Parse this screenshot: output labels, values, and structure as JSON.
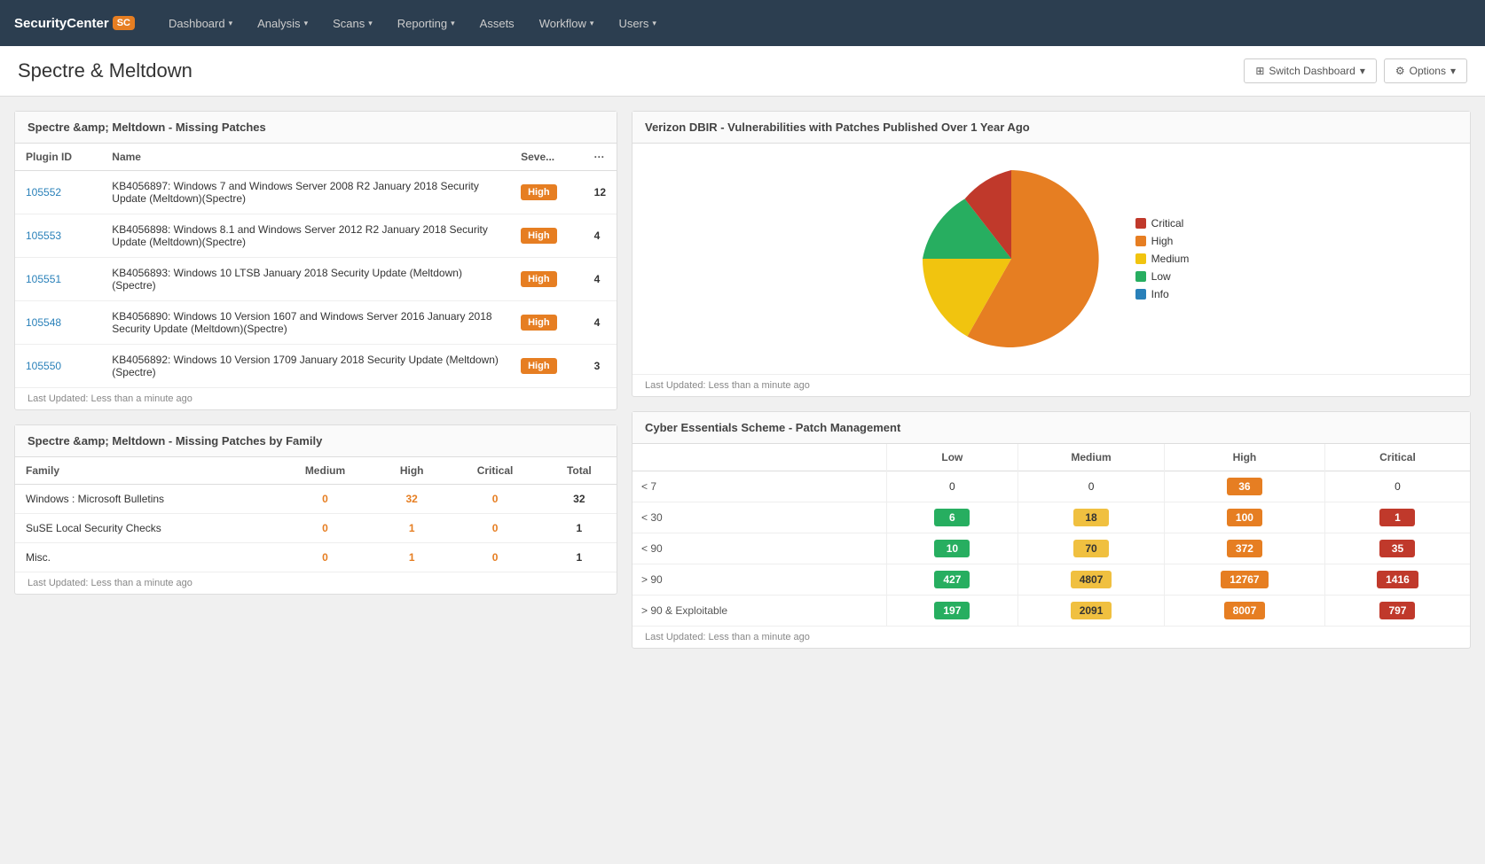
{
  "brand": {
    "name": "SecurityCenter",
    "badge": "SC"
  },
  "nav": {
    "items": [
      {
        "label": "Dashboard",
        "hasDropdown": true
      },
      {
        "label": "Analysis",
        "hasDropdown": true
      },
      {
        "label": "Scans",
        "hasDropdown": true
      },
      {
        "label": "Reporting",
        "hasDropdown": true
      },
      {
        "label": "Assets",
        "hasDropdown": false
      },
      {
        "label": "Workflow",
        "hasDropdown": true
      },
      {
        "label": "Users",
        "hasDropdown": true
      }
    ]
  },
  "page": {
    "title": "Spectre & Meltdown",
    "switch_dashboard_label": "Switch Dashboard",
    "options_label": "Options"
  },
  "panel1": {
    "title": "Spectre &amp; Meltdown - Missing Patches",
    "last_updated": "Last Updated: Less than a minute ago",
    "columns": [
      "Plugin ID",
      "Name",
      "Seve...",
      "..."
    ],
    "rows": [
      {
        "plugin_id": "105552",
        "name": "KB4056897: Windows 7 and Windows Server 2008 R2 January 2018 Security Update (Meltdown)(Spectre)",
        "severity": "High",
        "count": "12"
      },
      {
        "plugin_id": "105553",
        "name": "KB4056898: Windows 8.1 and Windows Server 2012 R2 January 2018 Security Update (Meltdown)(Spectre)",
        "severity": "High",
        "count": "4"
      },
      {
        "plugin_id": "105551",
        "name": "KB4056893: Windows 10 LTSB January 2018 Security Update (Meltdown)(Spectre)",
        "severity": "High",
        "count": "4"
      },
      {
        "plugin_id": "105548",
        "name": "KB4056890: Windows 10 Version 1607 and Windows Server 2016 January 2018 Security Update (Meltdown)(Spectre)",
        "severity": "High",
        "count": "4"
      },
      {
        "plugin_id": "105550",
        "name": "KB4056892: Windows 10 Version 1709 January 2018 Security Update (Meltdown)(Spectre)",
        "severity": "High",
        "count": "3"
      }
    ]
  },
  "panel2": {
    "title": "Spectre &amp; Meltdown - Missing Patches by Family",
    "last_updated": "Last Updated: Less than a minute ago",
    "columns": [
      "Family",
      "Medium",
      "High",
      "Critical",
      "Total"
    ],
    "rows": [
      {
        "family": "Windows : Microsoft Bulletins",
        "medium": "0",
        "high": "32",
        "critical": "0",
        "total": "32"
      },
      {
        "family": "SuSE Local Security Checks",
        "medium": "0",
        "high": "1",
        "critical": "0",
        "total": "1"
      },
      {
        "family": "Misc.",
        "medium": "0",
        "high": "1",
        "critical": "0",
        "total": "1"
      }
    ]
  },
  "panel3": {
    "title": "Verizon DBIR - Vulnerabilities with Patches Published Over 1 Year Ago",
    "last_updated": "Last Updated: Less than a minute ago",
    "legend": [
      {
        "label": "Critical",
        "color": "#c0392b"
      },
      {
        "label": "High",
        "color": "#e67e22"
      },
      {
        "label": "Medium",
        "color": "#f1c40f"
      },
      {
        "label": "Low",
        "color": "#27ae60"
      },
      {
        "label": "Info",
        "color": "#2980b9"
      }
    ],
    "pie": {
      "segments": [
        {
          "label": "Critical",
          "color": "#c0392b",
          "percent": 5
        },
        {
          "label": "High",
          "color": "#e67e22",
          "percent": 55
        },
        {
          "label": "Medium",
          "color": "#f1c40f",
          "percent": 25
        },
        {
          "label": "Low",
          "color": "#27ae60",
          "percent": 15
        }
      ]
    }
  },
  "panel4": {
    "title": "Cyber Essentials Scheme - Patch Management",
    "last_updated": "Last Updated: Less than a minute ago",
    "columns": [
      "",
      "Low",
      "Medium",
      "High",
      "Critical"
    ],
    "rows": [
      {
        "label": "< 7",
        "low": "0",
        "medium": "0",
        "high": "36",
        "critical": "0",
        "low_type": "empty",
        "medium_type": "empty",
        "high_type": "orange",
        "critical_type": "empty"
      },
      {
        "label": "< 30",
        "low": "6",
        "medium": "18",
        "high": "100",
        "critical": "1",
        "low_type": "green",
        "medium_type": "yellow",
        "high_type": "orange",
        "critical_type": "red"
      },
      {
        "label": "< 90",
        "low": "10",
        "medium": "70",
        "high": "372",
        "critical": "35",
        "low_type": "green",
        "medium_type": "yellow",
        "high_type": "orange",
        "critical_type": "red"
      },
      {
        "label": "> 90",
        "low": "427",
        "medium": "4807",
        "high": "12767",
        "critical": "1416",
        "low_type": "green",
        "medium_type": "yellow",
        "high_type": "orange",
        "critical_type": "red"
      },
      {
        "label": "> 90 & Exploitable",
        "low": "197",
        "medium": "2091",
        "high": "8007",
        "critical": "797",
        "low_type": "green",
        "medium_type": "yellow",
        "high_type": "orange",
        "critical_type": "red"
      }
    ]
  }
}
